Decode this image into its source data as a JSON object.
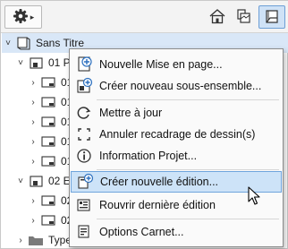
{
  "toolbar": {
    "buttons": [
      {
        "name": "view-map-icon"
      },
      {
        "name": "layout-book-icon"
      },
      {
        "name": "publisher-icon"
      }
    ]
  },
  "tree": {
    "root": {
      "label": "Sans Titre"
    },
    "rows": [
      {
        "label": "01 P"
      },
      {
        "label": "01"
      },
      {
        "label": "01"
      },
      {
        "label": "01"
      },
      {
        "label": "01"
      },
      {
        "label": "01"
      },
      {
        "label": "02 E"
      },
      {
        "label": "02"
      },
      {
        "label": "02"
      },
      {
        "label": "Type"
      }
    ]
  },
  "context_menu": {
    "items": [
      {
        "label": "Nouvelle Mise en page...",
        "icon": "new-layout-icon"
      },
      {
        "label": "Créer nouveau sous-ensemble...",
        "icon": "new-subset-icon"
      },
      {
        "label": "Mettre à jour",
        "icon": "refresh-icon"
      },
      {
        "label": "Annuler recadrage de dessin(s)",
        "icon": "crop-icon"
      },
      {
        "label": "Information Projet...",
        "icon": "info-icon"
      },
      {
        "label": "Créer nouvelle édition...",
        "icon": "new-issue-icon",
        "highlighted": true
      },
      {
        "label": "Rouvrir dernière édition",
        "icon": "reopen-issue-icon"
      },
      {
        "label": "Options Carnet...",
        "icon": "book-options-icon"
      }
    ]
  }
}
